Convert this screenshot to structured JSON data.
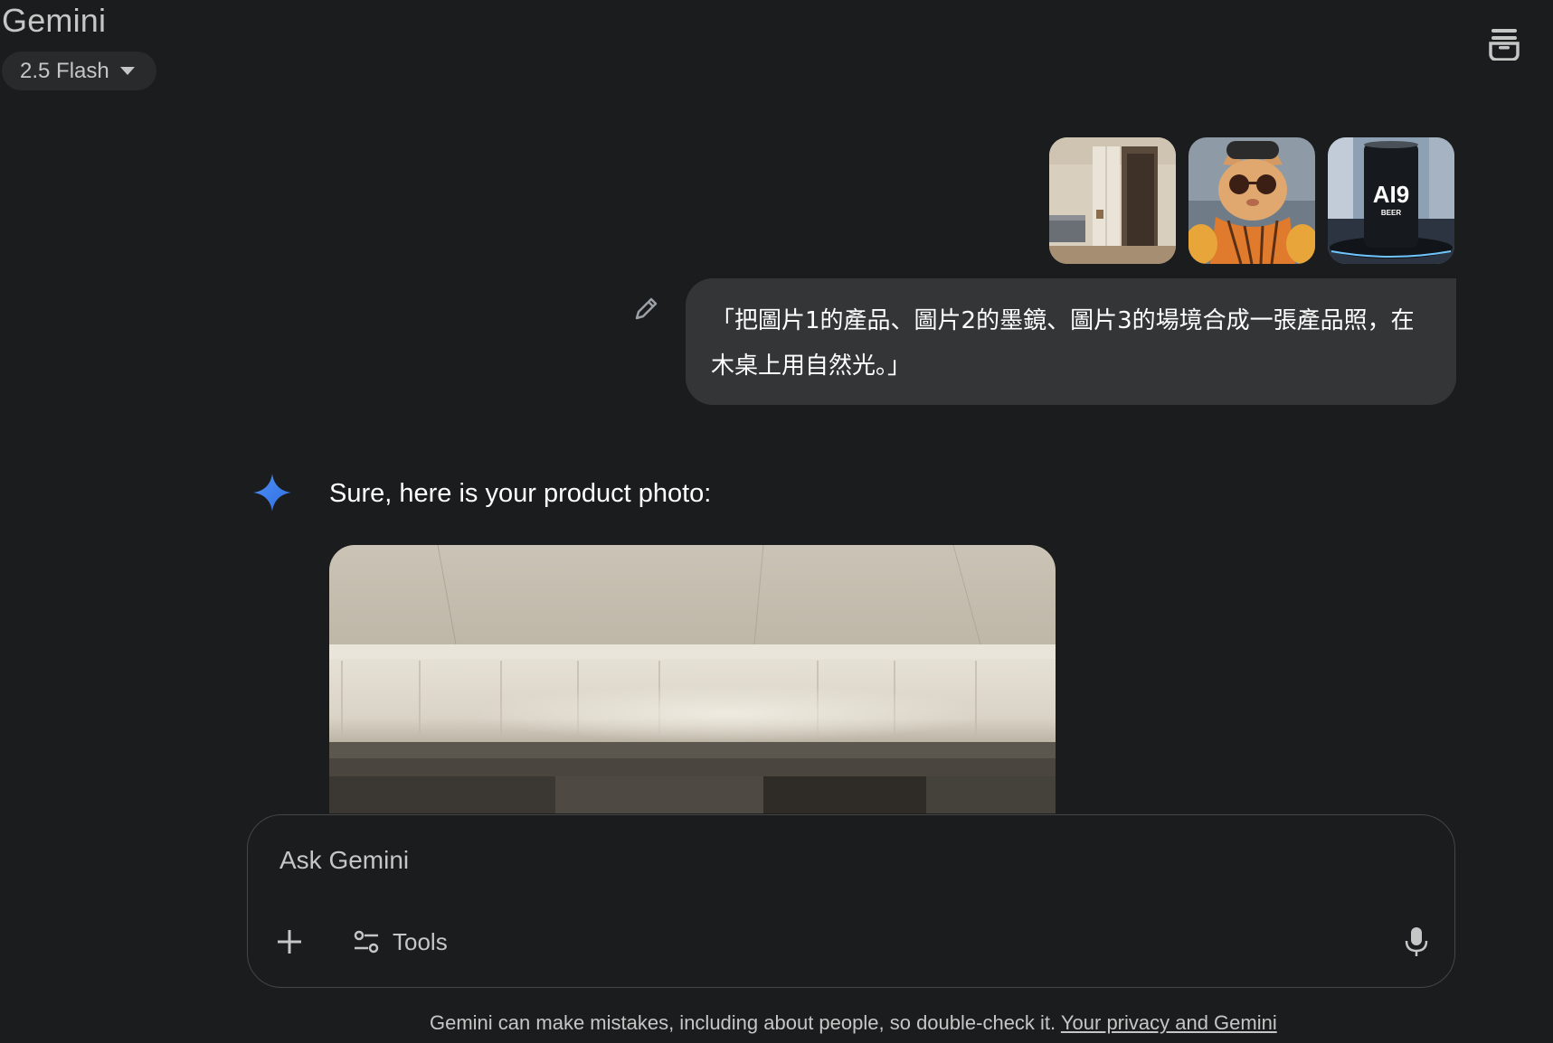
{
  "header": {
    "app_title": "Gemini",
    "model_label": "2.5 Flash",
    "temp_chat_icon": "temporary-chat-icon"
  },
  "conversation": {
    "user_message": {
      "attachments": [
        {
          "name": "room-photo",
          "alt": "bedroom with wardrobe"
        },
        {
          "name": "cat-photo",
          "alt": "cat with sunglasses and scarf"
        },
        {
          "name": "beer-can-photo",
          "alt": "AI9 beer can",
          "label_line1": "AI9",
          "label_line2": "BEER"
        }
      ],
      "text": "「把圖片1的產品、圖片2的墨鏡、圖片3的場境合成一張產品照，在木桌上用自然光。」"
    },
    "model_response": {
      "text": "Sure, here is your product photo:"
    }
  },
  "composer": {
    "placeholder": "Ask Gemini",
    "tools_label": "Tools"
  },
  "footer": {
    "disclaimer": "Gemini can make mistakes, including about people, so double-check it.",
    "privacy_link": "Your privacy and Gemini"
  },
  "colors": {
    "background": "#1b1c1d",
    "bubble": "#333537",
    "accent_blue": "#4285f4"
  }
}
